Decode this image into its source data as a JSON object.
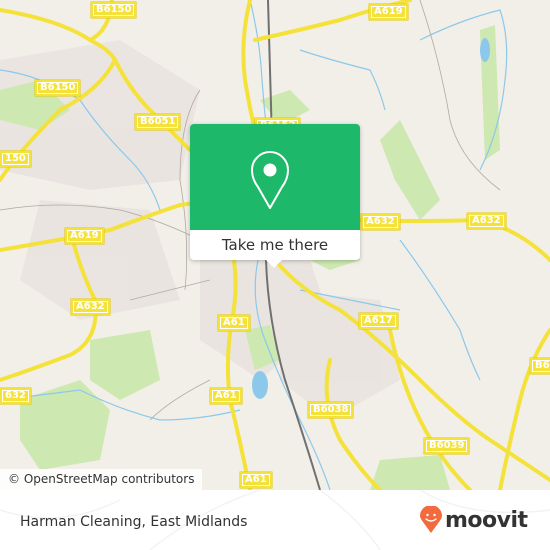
{
  "map": {
    "road_labels": [
      {
        "id": "b6150-top",
        "text": "B6150"
      },
      {
        "id": "a619-top",
        "text": "A619"
      },
      {
        "id": "b6150-mid",
        "text": "B6150"
      },
      {
        "id": "b6051",
        "text": "B6051"
      },
      {
        "id": "b6150-left",
        "text": "150"
      },
      {
        "id": "a619-left",
        "text": "A619"
      },
      {
        "id": "a632-right1",
        "text": "A632"
      },
      {
        "id": "a632-right2",
        "text": "A632"
      },
      {
        "id": "a632-left",
        "text": "A632"
      },
      {
        "id": "a61-mid",
        "text": "A61"
      },
      {
        "id": "a617",
        "text": "A617"
      },
      {
        "id": "a61-low",
        "text": "A61"
      },
      {
        "id": "b6038",
        "text": "B6038"
      },
      {
        "id": "b6039",
        "text": "B6039"
      },
      {
        "id": "a632-edge",
        "text": "632"
      },
      {
        "id": "b64-edge",
        "text": "B6"
      },
      {
        "id": "a61-bottom",
        "text": "A61"
      },
      {
        "id": "b6152-top",
        "text": "B6152"
      }
    ],
    "attribution": "© OpenStreetMap contributors",
    "colors": {
      "background": "#f2efe9",
      "road": "#f4e23a",
      "water": "#8cc8ea",
      "park": "#cde8b0",
      "rail": "#707070"
    }
  },
  "popup": {
    "button_label": "Take me there",
    "icon": "map-pin-icon",
    "accent": "#1db86a"
  },
  "footer": {
    "place_name": "Harman Cleaning, East Midlands",
    "brand": "moovit",
    "brand_color": "#f26a3d"
  }
}
